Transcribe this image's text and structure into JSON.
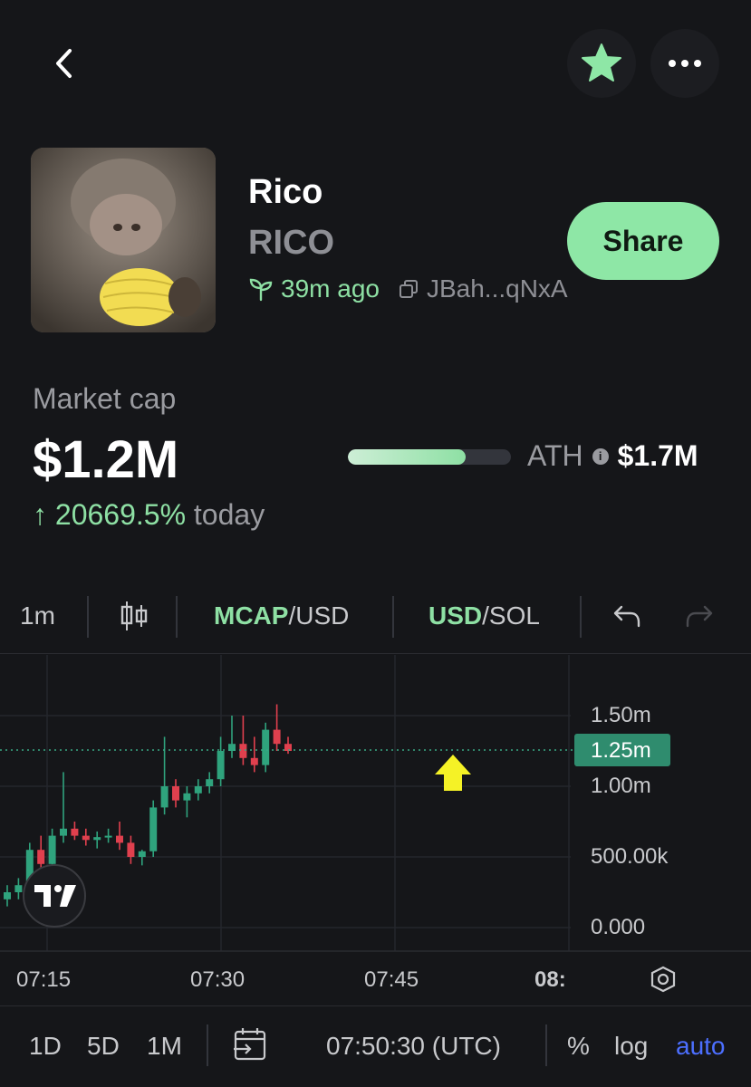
{
  "header": {
    "back_icon": "chevron-left-icon",
    "favorite_icon": "star-icon",
    "more_icon": "more-horizontal-icon",
    "favorite_color": "#8ee7a6"
  },
  "token": {
    "name": "Rico",
    "symbol": "RICO",
    "age": "39m ago",
    "address": "JBah...qNxA",
    "share_label": "Share"
  },
  "market": {
    "label": "Market cap",
    "value": "$1.2M",
    "change": "20669.5%",
    "change_suffix": "today",
    "ath_label": "ATH",
    "ath_value": "$1.7M",
    "ath_progress": 0.72
  },
  "toolbar": {
    "interval": "1m",
    "pair1_hl": "MCAP",
    "pair1_rest": "/USD",
    "pair2_hl": "USD",
    "pair2_rest": "/SOL"
  },
  "chart": {
    "price_labels": [
      "1.50m",
      "1.25m",
      "1.00m",
      "500.00k",
      "0.000"
    ],
    "current_price": "1.25m",
    "time_labels": [
      "07:15",
      "07:30",
      "07:45",
      "08:"
    ]
  },
  "chart_data": {
    "type": "candlestick",
    "yticks": [
      "1.50m",
      "1.00m",
      "500.00k",
      "0.000"
    ],
    "xticks": [
      "07:15",
      "07:30",
      "07:45",
      "08:"
    ],
    "ylim": [
      0,
      1700000
    ],
    "last_price": 1250000,
    "ohlc": [
      [
        0,
        200000,
        300000,
        150000,
        250000
      ],
      [
        1,
        250000,
        350000,
        200000,
        300000
      ],
      [
        2,
        300000,
        600000,
        250000,
        550000
      ],
      [
        3,
        550000,
        650000,
        400000,
        450000
      ],
      [
        4,
        450000,
        700000,
        420000,
        650000
      ],
      [
        5,
        650000,
        1100000,
        600000,
        700000
      ],
      [
        6,
        700000,
        750000,
        620000,
        650000
      ],
      [
        7,
        650000,
        700000,
        580000,
        620000
      ],
      [
        8,
        620000,
        680000,
        560000,
        640000
      ],
      [
        9,
        640000,
        700000,
        600000,
        650000
      ],
      [
        10,
        650000,
        750000,
        550000,
        600000
      ],
      [
        11,
        600000,
        650000,
        450000,
        500000
      ],
      [
        12,
        500000,
        550000,
        440000,
        540000
      ],
      [
        13,
        540000,
        900000,
        500000,
        850000
      ],
      [
        14,
        850000,
        1350000,
        800000,
        1000000
      ],
      [
        15,
        1000000,
        1050000,
        850000,
        900000
      ],
      [
        16,
        900000,
        1000000,
        780000,
        950000
      ],
      [
        17,
        950000,
        1050000,
        900000,
        1000000
      ],
      [
        18,
        1000000,
        1100000,
        950000,
        1050000
      ],
      [
        19,
        1050000,
        1350000,
        1000000,
        1250000
      ],
      [
        20,
        1250000,
        1500000,
        1200000,
        1300000
      ],
      [
        21,
        1300000,
        1500000,
        1150000,
        1200000
      ],
      [
        22,
        1200000,
        1350000,
        1100000,
        1150000
      ],
      [
        23,
        1150000,
        1450000,
        1100000,
        1400000
      ],
      [
        24,
        1400000,
        1580000,
        1250000,
        1300000
      ],
      [
        25,
        1300000,
        1350000,
        1230000,
        1250000
      ]
    ]
  },
  "timebar": {
    "range1": "1D",
    "range2": "5D",
    "range3": "1M",
    "clock": "07:50:30 (UTC)",
    "pct": "%",
    "log": "log",
    "auto": "auto"
  }
}
